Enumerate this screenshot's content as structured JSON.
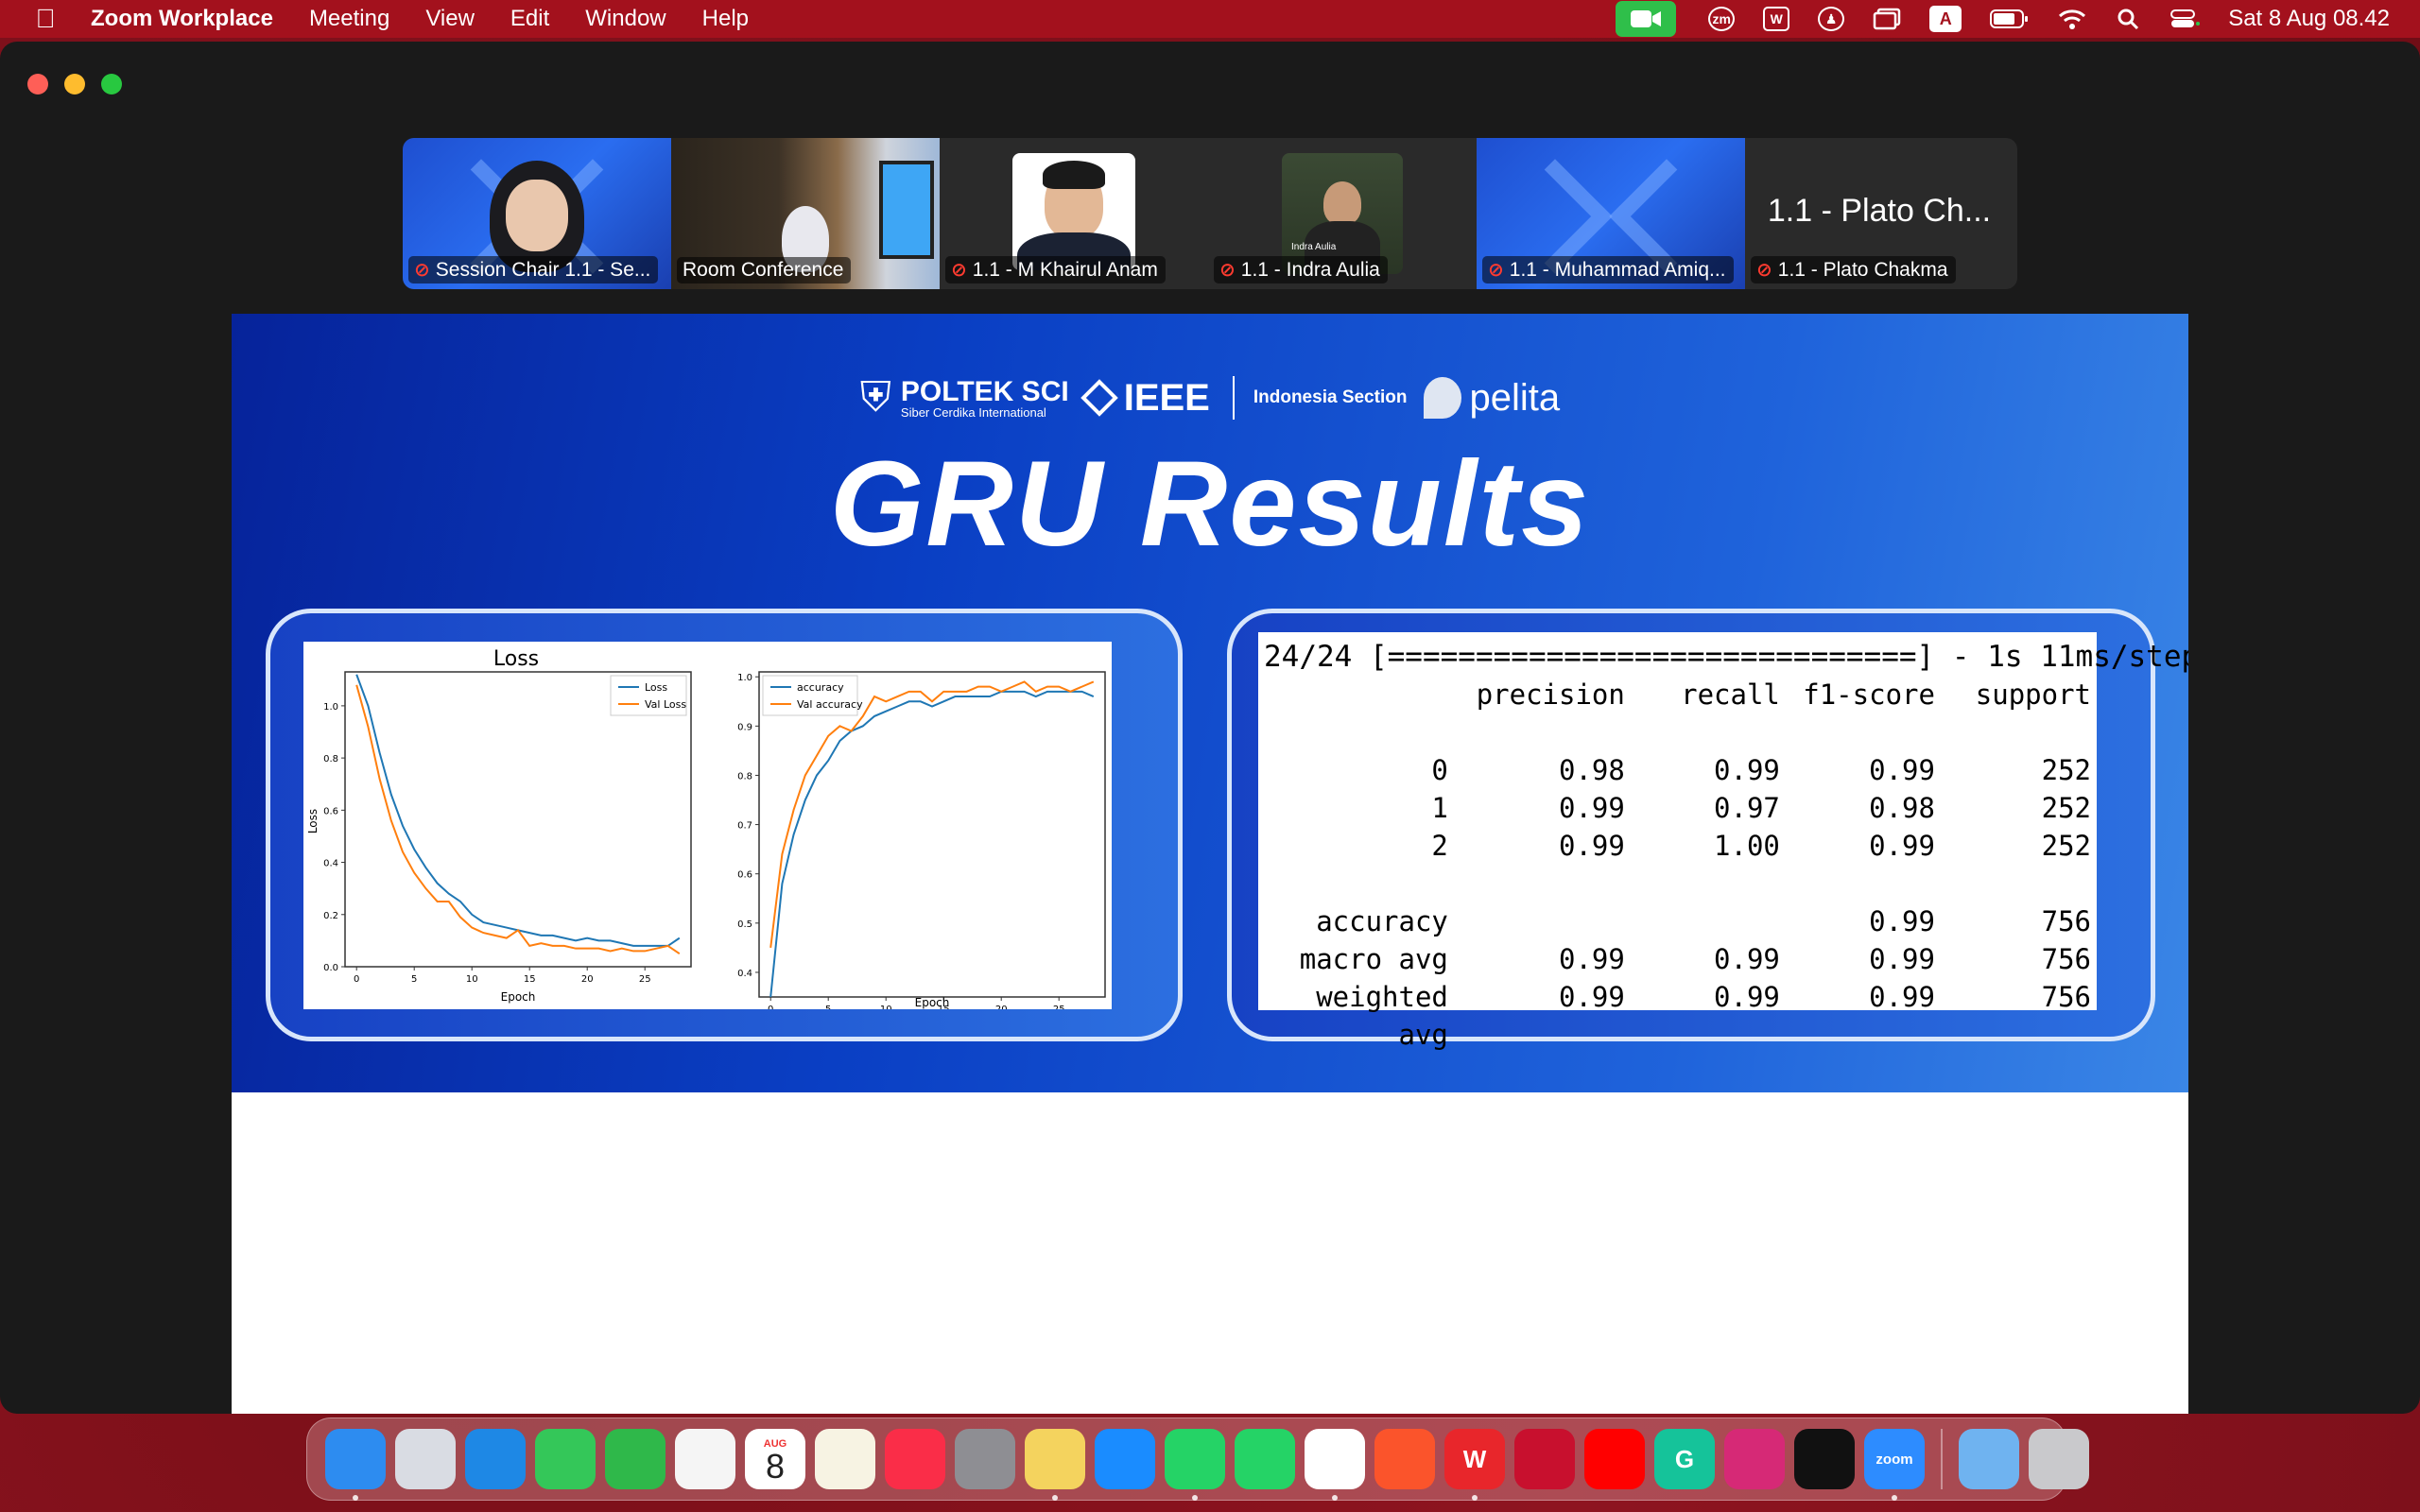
{
  "menubar": {
    "app_name": "Zoom Workplace",
    "menus": [
      "Meeting",
      "View",
      "Edit",
      "Window",
      "Help"
    ],
    "status_icons": [
      "zoom-video-icon",
      "zm-icon",
      "wps-icon",
      "accessibility-icon",
      "screens-icon",
      "input-source-icon",
      "battery-icon",
      "wifi-icon",
      "search-icon",
      "control-center-icon"
    ],
    "input_source": "A",
    "zm_label": "zm",
    "clock": "Sat 8 Aug  08.42",
    "bar_color": "#a3111d"
  },
  "participants": [
    {
      "name": "Session Chair 1.1 - Se...",
      "muted": true,
      "video": true,
      "active": false
    },
    {
      "name": "Room Conference",
      "muted": false,
      "video": true,
      "active": true
    },
    {
      "name": "1.1 - M Khairul Anam",
      "muted": true,
      "video": true,
      "active": false
    },
    {
      "name": "1.1 - Indra Aulia",
      "muted": true,
      "video": true,
      "active": false
    },
    {
      "name": "1.1 - Muhammad Amiq...",
      "muted": true,
      "video": true,
      "active": false
    },
    {
      "name": "1.1 - Plato Chakma",
      "muted": true,
      "video": false,
      "active": false,
      "display_name": "1.1 - Plato Ch..."
    }
  ],
  "photo_caption": "Indra Aulia",
  "slide": {
    "logos": {
      "poltek": "POLTEK SCI",
      "poltek_sub": "Siber Cerdika International",
      "ieee": "IEEE",
      "section": "Indonesia Section",
      "pelita": "pelita"
    },
    "title": "GRU Results",
    "loss_chart": {
      "title": "Loss",
      "xlabel": "Epoch",
      "ylabel": "Loss",
      "legend": [
        "Loss",
        "Val Loss"
      ],
      "x_ticks": [
        "0",
        "5",
        "10",
        "15",
        "20",
        "25"
      ],
      "y_ticks": [
        "0.0",
        "0.2",
        "0.4",
        "0.6",
        "0.8",
        "1.0"
      ]
    },
    "acc_chart": {
      "xlabel": "Epoch",
      "legend": [
        "accuracy",
        "Val accuracy"
      ],
      "x_ticks": [
        "0",
        "5",
        "10",
        "15",
        "20",
        "25"
      ],
      "y_ticks": [
        "0.4",
        "0.5",
        "0.6",
        "0.7",
        "0.8",
        "0.9",
        "1.0"
      ]
    },
    "report": {
      "progress_line": "24/24 [==============================] - 1s 11ms/step",
      "header": [
        "",
        "precision",
        "recall",
        "f1-score",
        "support"
      ],
      "class_rows": [
        [
          "0",
          "0.98",
          "0.99",
          "0.99",
          "252"
        ],
        [
          "1",
          "0.99",
          "0.97",
          "0.98",
          "252"
        ],
        [
          "2",
          "0.99",
          "1.00",
          "0.99",
          "252"
        ]
      ],
      "summary_rows": [
        [
          "accuracy",
          "",
          "",
          "0.99",
          "756"
        ],
        [
          "macro avg",
          "0.99",
          "0.99",
          "0.99",
          "756"
        ],
        [
          "weighted avg",
          "0.99",
          "0.99",
          "0.99",
          "756"
        ]
      ]
    }
  },
  "chart_data": [
    {
      "type": "line",
      "title": "Loss",
      "xlabel": "Epoch",
      "ylabel": "Loss",
      "xlim": [
        -1,
        29
      ],
      "ylim": [
        0,
        1.13
      ],
      "x": [
        0,
        1,
        2,
        3,
        4,
        5,
        6,
        7,
        8,
        9,
        10,
        11,
        12,
        13,
        14,
        15,
        16,
        17,
        18,
        19,
        20,
        21,
        22,
        23,
        24,
        25,
        26,
        27,
        28
      ],
      "series": [
        {
          "name": "Loss",
          "color": "#1f77b4",
          "values": [
            1.12,
            1.0,
            0.82,
            0.66,
            0.54,
            0.45,
            0.38,
            0.32,
            0.28,
            0.25,
            0.2,
            0.17,
            0.16,
            0.15,
            0.14,
            0.13,
            0.12,
            0.12,
            0.11,
            0.1,
            0.11,
            0.1,
            0.1,
            0.09,
            0.08,
            0.08,
            0.08,
            0.08,
            0.11
          ]
        },
        {
          "name": "Val Loss",
          "color": "#ff7f0e",
          "values": [
            1.08,
            0.92,
            0.72,
            0.56,
            0.44,
            0.36,
            0.3,
            0.25,
            0.25,
            0.19,
            0.15,
            0.13,
            0.12,
            0.11,
            0.14,
            0.08,
            0.09,
            0.08,
            0.08,
            0.07,
            0.07,
            0.07,
            0.06,
            0.07,
            0.06,
            0.06,
            0.07,
            0.08,
            0.05
          ]
        }
      ],
      "legend_position": "top-right"
    },
    {
      "type": "line",
      "title": "",
      "xlabel": "Epoch",
      "ylabel": "",
      "xlim": [
        -1,
        29
      ],
      "ylim": [
        0.35,
        1.01
      ],
      "x": [
        0,
        1,
        2,
        3,
        4,
        5,
        6,
        7,
        8,
        9,
        10,
        11,
        12,
        13,
        14,
        15,
        16,
        17,
        18,
        19,
        20,
        21,
        22,
        23,
        24,
        25,
        26,
        27,
        28
      ],
      "series": [
        {
          "name": "accuracy",
          "color": "#1f77b4",
          "values": [
            0.35,
            0.58,
            0.68,
            0.75,
            0.8,
            0.83,
            0.87,
            0.89,
            0.9,
            0.92,
            0.93,
            0.94,
            0.95,
            0.95,
            0.94,
            0.95,
            0.96,
            0.96,
            0.96,
            0.96,
            0.97,
            0.97,
            0.97,
            0.96,
            0.97,
            0.97,
            0.97,
            0.97,
            0.96
          ]
        },
        {
          "name": "Val accuracy",
          "color": "#ff7f0e",
          "values": [
            0.45,
            0.64,
            0.73,
            0.8,
            0.84,
            0.88,
            0.9,
            0.89,
            0.92,
            0.96,
            0.95,
            0.96,
            0.97,
            0.97,
            0.95,
            0.97,
            0.97,
            0.97,
            0.98,
            0.98,
            0.97,
            0.98,
            0.99,
            0.97,
            0.98,
            0.98,
            0.97,
            0.98,
            0.99
          ]
        }
      ],
      "legend_position": "top-left"
    }
  ],
  "dock": {
    "apps": [
      {
        "name": "finder",
        "label": "",
        "color": "#2d8cf0",
        "running": true
      },
      {
        "name": "launchpad",
        "label": "",
        "color": "#d9dce3",
        "running": false
      },
      {
        "name": "safari",
        "label": "",
        "color": "#1e88e5",
        "running": false
      },
      {
        "name": "messages",
        "label": "",
        "color": "#34c759",
        "running": false
      },
      {
        "name": "facetime",
        "label": "",
        "color": "#2fb84a",
        "running": false
      },
      {
        "name": "photos",
        "label": "",
        "color": "#f5f5f5",
        "running": false
      },
      {
        "name": "calendar",
        "label": "",
        "color": "#ffffff",
        "running": false,
        "month": "AUG",
        "day": "8"
      },
      {
        "name": "notes",
        "label": "",
        "color": "#f7f3e3",
        "running": false
      },
      {
        "name": "music",
        "label": "",
        "color": "#fa2d48",
        "running": false
      },
      {
        "name": "system-settings",
        "label": "",
        "color": "#8e8e93",
        "running": false
      },
      {
        "name": "stickies",
        "label": "",
        "color": "#f4d35e",
        "running": true
      },
      {
        "name": "app-store",
        "label": "",
        "color": "#1a8cff",
        "running": false
      },
      {
        "name": "whatsapp-business",
        "label": "",
        "color": "#25d366",
        "running": true
      },
      {
        "name": "whatsapp",
        "label": "",
        "color": "#25d366",
        "running": false
      },
      {
        "name": "chrome",
        "label": "",
        "color": "#ffffff",
        "running": true
      },
      {
        "name": "brave",
        "label": "",
        "color": "#fb542b",
        "running": false
      },
      {
        "name": "wps-office",
        "label": "W",
        "color": "#e8262b",
        "running": true
      },
      {
        "name": "mendeley",
        "label": "",
        "color": "#c8102e",
        "running": false
      },
      {
        "name": "youtube",
        "label": "",
        "color": "#ff0000",
        "running": false
      },
      {
        "name": "grammarly",
        "label": "G",
        "color": "#15c39a",
        "running": false
      },
      {
        "name": "instagram",
        "label": "",
        "color": "#d62976",
        "running": false
      },
      {
        "name": "tiktok",
        "label": "",
        "color": "#111111",
        "running": false
      },
      {
        "name": "zoom",
        "label": "zoom",
        "color": "#2d8cff",
        "running": true
      }
    ],
    "trailing": [
      {
        "name": "downloads",
        "label": "",
        "color": "#6fb3f0",
        "running": false
      },
      {
        "name": "trash",
        "label": "",
        "color": "#c9c9cc",
        "running": false
      }
    ]
  }
}
